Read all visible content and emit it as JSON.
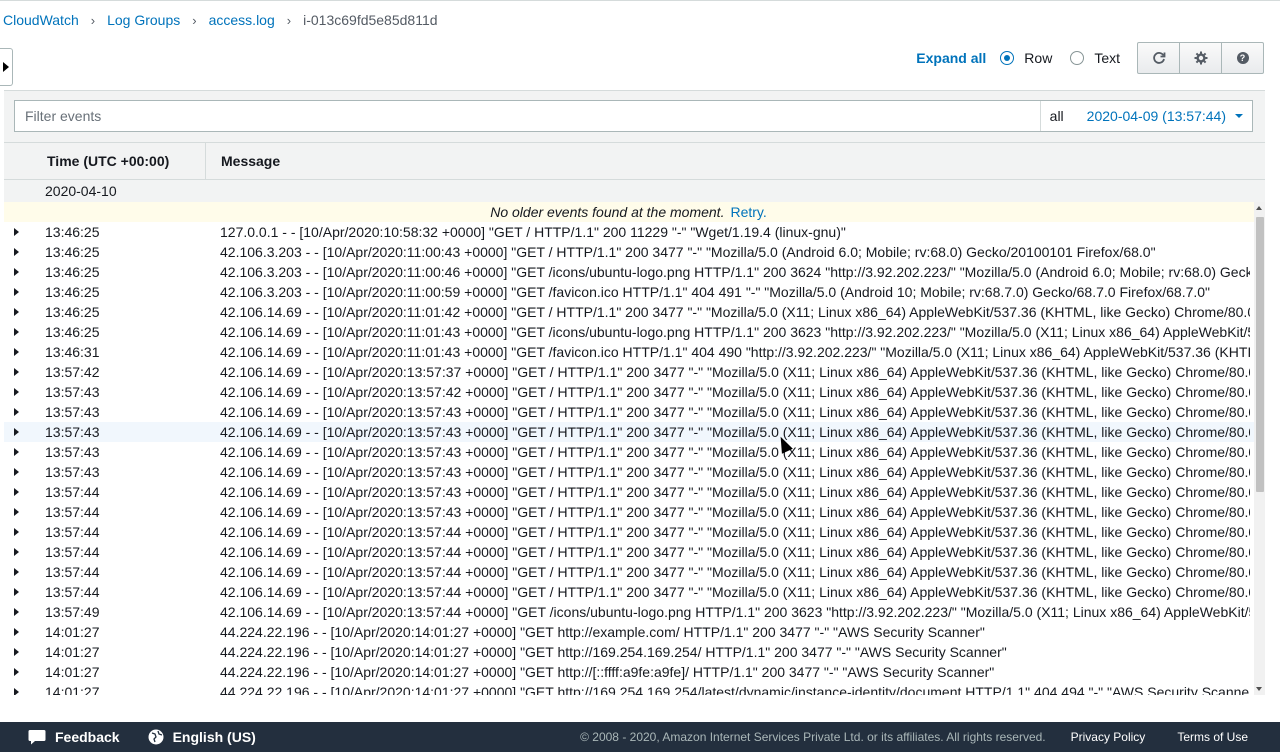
{
  "breadcrumb": {
    "items": [
      "CloudWatch",
      "Log Groups",
      "access.log"
    ],
    "current": "i-013c69fd5e85d811d",
    "separator": "›"
  },
  "toolbar": {
    "expand_all": "Expand all",
    "view_row": "Row",
    "view_text": "Text",
    "selected_view": "Row",
    "icons": [
      "refresh-icon",
      "gear-icon",
      "help-icon"
    ]
  },
  "filter": {
    "placeholder": "Filter events",
    "range_all": "all",
    "range_date": "2020-04-09 (13:57:44)"
  },
  "table": {
    "col_time": "Time (UTC +00:00)",
    "col_message": "Message",
    "date_group": "2020-04-10",
    "notice_text": "No older events found at the moment.",
    "notice_retry": "Retry.",
    "rows": [
      {
        "time": "13:46:25",
        "message": "127.0.0.1 - - [10/Apr/2020:10:58:32 +0000] \"GET / HTTP/1.1\" 200 11229 \"-\" \"Wget/1.19.4 (linux-gnu)\""
      },
      {
        "time": "13:46:25",
        "message": "42.106.3.203 - - [10/Apr/2020:11:00:43 +0000] \"GET / HTTP/1.1\" 200 3477 \"-\" \"Mozilla/5.0 (Android 6.0; Mobile; rv:68.0) Gecko/20100101 Firefox/68.0\""
      },
      {
        "time": "13:46:25",
        "message": "42.106.3.203 - - [10/Apr/2020:11:00:46 +0000] \"GET /icons/ubuntu-logo.png HTTP/1.1\" 200 3624 \"http://3.92.202.223/\" \"Mozilla/5.0 (Android 6.0; Mobile; rv:68.0) Geck"
      },
      {
        "time": "13:46:25",
        "message": "42.106.3.203 - - [10/Apr/2020:11:00:59 +0000] \"GET /favicon.ico HTTP/1.1\" 404 491 \"-\" \"Mozilla/5.0 (Android 10; Mobile; rv:68.7.0) Gecko/68.7.0 Firefox/68.7.0\""
      },
      {
        "time": "13:46:25",
        "message": "42.106.14.69 - - [10/Apr/2020:11:01:42 +0000] \"GET / HTTP/1.1\" 200 3477 \"-\" \"Mozilla/5.0 (X11; Linux x86_64) AppleWebKit/537.36 (KHTML, like Gecko) Chrome/80.0"
      },
      {
        "time": "13:46:25",
        "message": "42.106.14.69 - - [10/Apr/2020:11:01:43 +0000] \"GET /icons/ubuntu-logo.png HTTP/1.1\" 200 3623 \"http://3.92.202.223/\" \"Mozilla/5.0 (X11; Linux x86_64) AppleWebKit/5"
      },
      {
        "time": "13:46:31",
        "message": "42.106.14.69 - - [10/Apr/2020:11:01:43 +0000] \"GET /favicon.ico HTTP/1.1\" 404 490 \"http://3.92.202.223/\" \"Mozilla/5.0 (X11; Linux x86_64) AppleWebKit/537.36 (KHTI"
      },
      {
        "time": "13:57:42",
        "message": "42.106.14.69 - - [10/Apr/2020:13:57:37 +0000] \"GET / HTTP/1.1\" 200 3477 \"-\" \"Mozilla/5.0 (X11; Linux x86_64) AppleWebKit/537.36 (KHTML, like Gecko) Chrome/80.0"
      },
      {
        "time": "13:57:43",
        "message": "42.106.14.69 - - [10/Apr/2020:13:57:42 +0000] \"GET / HTTP/1.1\" 200 3477 \"-\" \"Mozilla/5.0 (X11; Linux x86_64) AppleWebKit/537.36 (KHTML, like Gecko) Chrome/80.0"
      },
      {
        "time": "13:57:43",
        "message": "42.106.14.69 - - [10/Apr/2020:13:57:43 +0000] \"GET / HTTP/1.1\" 200 3477 \"-\" \"Mozilla/5.0 (X11; Linux x86_64) AppleWebKit/537.36 (KHTML, like Gecko) Chrome/80.0"
      },
      {
        "time": "13:57:43",
        "message": "42.106.14.69 - - [10/Apr/2020:13:57:43 +0000] \"GET / HTTP/1.1\" 200 3477 \"-\" \"Mozilla/5.0 (X11; Linux x86_64) AppleWebKit/537.36 (KHTML, like Gecko) Chrome/80.0"
      },
      {
        "time": "13:57:43",
        "message": "42.106.14.69 - - [10/Apr/2020:13:57:43 +0000] \"GET / HTTP/1.1\" 200 3477 \"-\" \"Mozilla/5.0 (X11; Linux x86_64) AppleWebKit/537.36 (KHTML, like Gecko) Chrome/80.0"
      },
      {
        "time": "13:57:43",
        "message": "42.106.14.69 - - [10/Apr/2020:13:57:43 +0000] \"GET / HTTP/1.1\" 200 3477 \"-\" \"Mozilla/5.0 (X11; Linux x86_64) AppleWebKit/537.36 (KHTML, like Gecko) Chrome/80.0"
      },
      {
        "time": "13:57:44",
        "message": "42.106.14.69 - - [10/Apr/2020:13:57:43 +0000] \"GET / HTTP/1.1\" 200 3477 \"-\" \"Mozilla/5.0 (X11; Linux x86_64) AppleWebKit/537.36 (KHTML, like Gecko) Chrome/80.0"
      },
      {
        "time": "13:57:44",
        "message": "42.106.14.69 - - [10/Apr/2020:13:57:43 +0000] \"GET / HTTP/1.1\" 200 3477 \"-\" \"Mozilla/5.0 (X11; Linux x86_64) AppleWebKit/537.36 (KHTML, like Gecko) Chrome/80.0"
      },
      {
        "time": "13:57:44",
        "message": "42.106.14.69 - - [10/Apr/2020:13:57:44 +0000] \"GET / HTTP/1.1\" 200 3477 \"-\" \"Mozilla/5.0 (X11; Linux x86_64) AppleWebKit/537.36 (KHTML, like Gecko) Chrome/80.0"
      },
      {
        "time": "13:57:44",
        "message": "42.106.14.69 - - [10/Apr/2020:13:57:44 +0000] \"GET / HTTP/1.1\" 200 3477 \"-\" \"Mozilla/5.0 (X11; Linux x86_64) AppleWebKit/537.36 (KHTML, like Gecko) Chrome/80.0"
      },
      {
        "time": "13:57:44",
        "message": "42.106.14.69 - - [10/Apr/2020:13:57:44 +0000] \"GET / HTTP/1.1\" 200 3477 \"-\" \"Mozilla/5.0 (X11; Linux x86_64) AppleWebKit/537.36 (KHTML, like Gecko) Chrome/80.0"
      },
      {
        "time": "13:57:44",
        "message": "42.106.14.69 - - [10/Apr/2020:13:57:44 +0000] \"GET / HTTP/1.1\" 200 3477 \"-\" \"Mozilla/5.0 (X11; Linux x86_64) AppleWebKit/537.36 (KHTML, like Gecko) Chrome/80.0"
      },
      {
        "time": "13:57:49",
        "message": "42.106.14.69 - - [10/Apr/2020:13:57:44 +0000] \"GET /icons/ubuntu-logo.png HTTP/1.1\" 200 3623 \"http://3.92.202.223/\" \"Mozilla/5.0 (X11; Linux x86_64) AppleWebKit/5"
      },
      {
        "time": "14:01:27",
        "message": "44.224.22.196 - - [10/Apr/2020:14:01:27 +0000] \"GET http://example.com/ HTTP/1.1\" 200 3477 \"-\" \"AWS Security Scanner\""
      },
      {
        "time": "14:01:27",
        "message": "44.224.22.196 - - [10/Apr/2020:14:01:27 +0000] \"GET http://169.254.169.254/ HTTP/1.1\" 200 3477 \"-\" \"AWS Security Scanner\""
      },
      {
        "time": "14:01:27",
        "message": "44.224.22.196 - - [10/Apr/2020:14:01:27 +0000] \"GET http://[::ffff:a9fe:a9fe]/ HTTP/1.1\" 200 3477 \"-\" \"AWS Security Scanner\""
      },
      {
        "time": "14:01:27",
        "message": "44.224.22.196 - - [10/Apr/2020:14:01:27 +0000] \"GET http://169.254.169.254/latest/dynamic/instance-identity/document HTTP/1.1\" 404 494 \"-\" \"AWS Security Scanne"
      }
    ],
    "highlighted_row_index": 10
  },
  "footer": {
    "feedback": "Feedback",
    "language": "English (US)",
    "copyright": "© 2008 - 2020, Amazon Internet Services Private Ltd. or its affiliates. All rights reserved.",
    "privacy": "Privacy Policy",
    "terms": "Terms of Use"
  }
}
